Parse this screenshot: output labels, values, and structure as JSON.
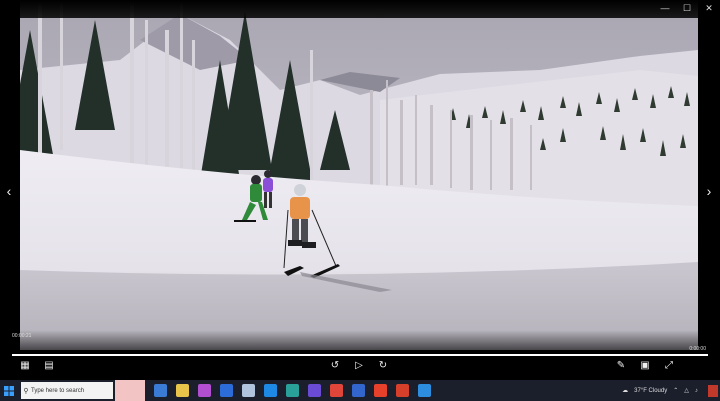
{
  "window": {
    "controls": [
      "minimize-icon",
      "maximize-icon",
      "close-icon"
    ],
    "minimize_glyph": "—",
    "maximize_glyph": "☐",
    "close_glyph": "✕"
  },
  "player": {
    "time_elapsed_label": "00:00:21",
    "time_remaining_label": "0:00:00",
    "progress_fraction": 1.0,
    "icons": [
      "previous-icon",
      "next-icon",
      "subtitles-icon",
      "rewind-10-icon",
      "play-icon",
      "forward-30-icon",
      "edit-icon",
      "miniplayer-icon",
      "fullscreen-icon"
    ]
  },
  "taskbar": {
    "search_placeholder": "Type here to search",
    "weather_text": "37°F Cloudy",
    "accent_color": "#1b1e2b",
    "app_icon_colors": [
      "#3a7bd5",
      "#e8c44a",
      "#b24fd1",
      "#2b6cd9",
      "#b0c4de",
      "#1e88e5",
      "#2aa198",
      "#6a4cd4",
      "#e0453a",
      "#3366cc",
      "#e8412b",
      "#d6402b",
      "#2d8ee0"
    ]
  },
  "colors": {
    "sky": "#b9b6bf",
    "snow": "#e9e6ef",
    "jacket_orange": "#e8934a",
    "jacket_green": "#2f8a3a",
    "jacket_purple": "#8a4fd6"
  }
}
